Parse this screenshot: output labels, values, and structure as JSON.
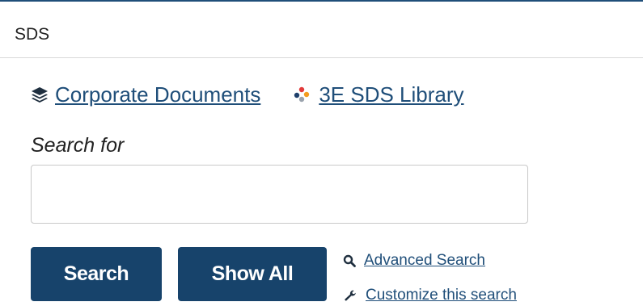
{
  "header": {
    "title": "SDS"
  },
  "links": {
    "corporate": {
      "label": "Corporate Documents",
      "icon": "layers-icon"
    },
    "library": {
      "label": "3E SDS Library",
      "icon": "dots-cluster-icon"
    }
  },
  "search": {
    "label": "Search for",
    "value": "",
    "placeholder": ""
  },
  "buttons": {
    "search_label": "Search",
    "show_all_label": "Show All"
  },
  "secondary_links": {
    "advanced_label": "Advanced Search",
    "advanced_icon": "magnifier-icon",
    "customize_label": "Customize this search",
    "customize_icon": "wrench-icon"
  },
  "colors": {
    "accent": "#1f4e79",
    "button_bg": "#17436b"
  }
}
